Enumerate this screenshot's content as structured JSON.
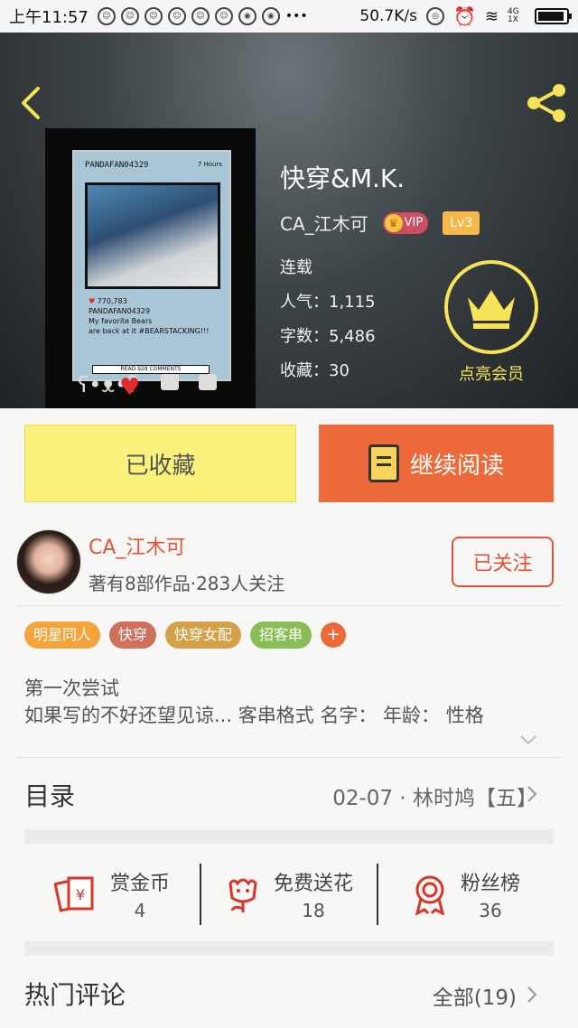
{
  "status_bar": {
    "time": "上午11:57",
    "icons": [
      "notify-icon",
      "notify-icon",
      "notify-icon",
      "notify-icon",
      "notify-icon",
      "notify-icon",
      "weibo-icon",
      "weibo-icon"
    ],
    "more": "•••",
    "speed": "50.7K/s",
    "network": "4G 1X"
  },
  "book": {
    "title": "快穿&M.K.",
    "author": "CA_江木可",
    "vip_label": "VIP",
    "level": "Lv3",
    "status": "连载",
    "popularity": "人气：1,115",
    "word_count": "字数：5,486",
    "favorites": "收藏：30",
    "member_label": "点亮会员",
    "cover": {
      "ig_name": "PANDAFAN04329",
      "ig_time": "7 Hours",
      "likes": "770,783",
      "caption_user": "PANDAFAN04329",
      "caption_1": "My favorite Bears",
      "caption_2": "are back at it #BEARSTACKING!!!",
      "comments_button": "READ 928 COMMENTS"
    }
  },
  "actions": {
    "favorited_label": "已收藏",
    "continue_label": "继续阅读"
  },
  "author": {
    "name": "CA_江木可",
    "info": "著有8部作品·283人关注",
    "follow_label": "已关注"
  },
  "tags": [
    {
      "label": "明星同人",
      "color": "#f5a43c"
    },
    {
      "label": "快穿",
      "color": "#cf6f5c"
    },
    {
      "label": "快穿女配",
      "color": "#d4a04a"
    },
    {
      "label": "招客串",
      "color": "#8bbd57"
    }
  ],
  "tag_add": "+",
  "description": {
    "line1": "第一次尝试",
    "line2": "如果写的不好还望见谅... 客串格式 名字： 年龄： 性格"
  },
  "toc": {
    "label": "目录",
    "latest": "02-07 · 林时鸠【五】"
  },
  "rewards": [
    {
      "label": "赏金币",
      "value": "4",
      "icon": "red-envelope-icon"
    },
    {
      "label": "免费送花",
      "value": "18",
      "icon": "flower-icon"
    },
    {
      "label": "粉丝榜",
      "value": "36",
      "icon": "medal-icon"
    }
  ],
  "comments": {
    "label": "热门评论",
    "all_label": "全部(19)"
  },
  "colors": {
    "accent_orange": "#ec6a3a",
    "favorite_yellow": "#fbf27d",
    "author_red": "#e0533b",
    "member_yellow": "#f6e35a"
  }
}
